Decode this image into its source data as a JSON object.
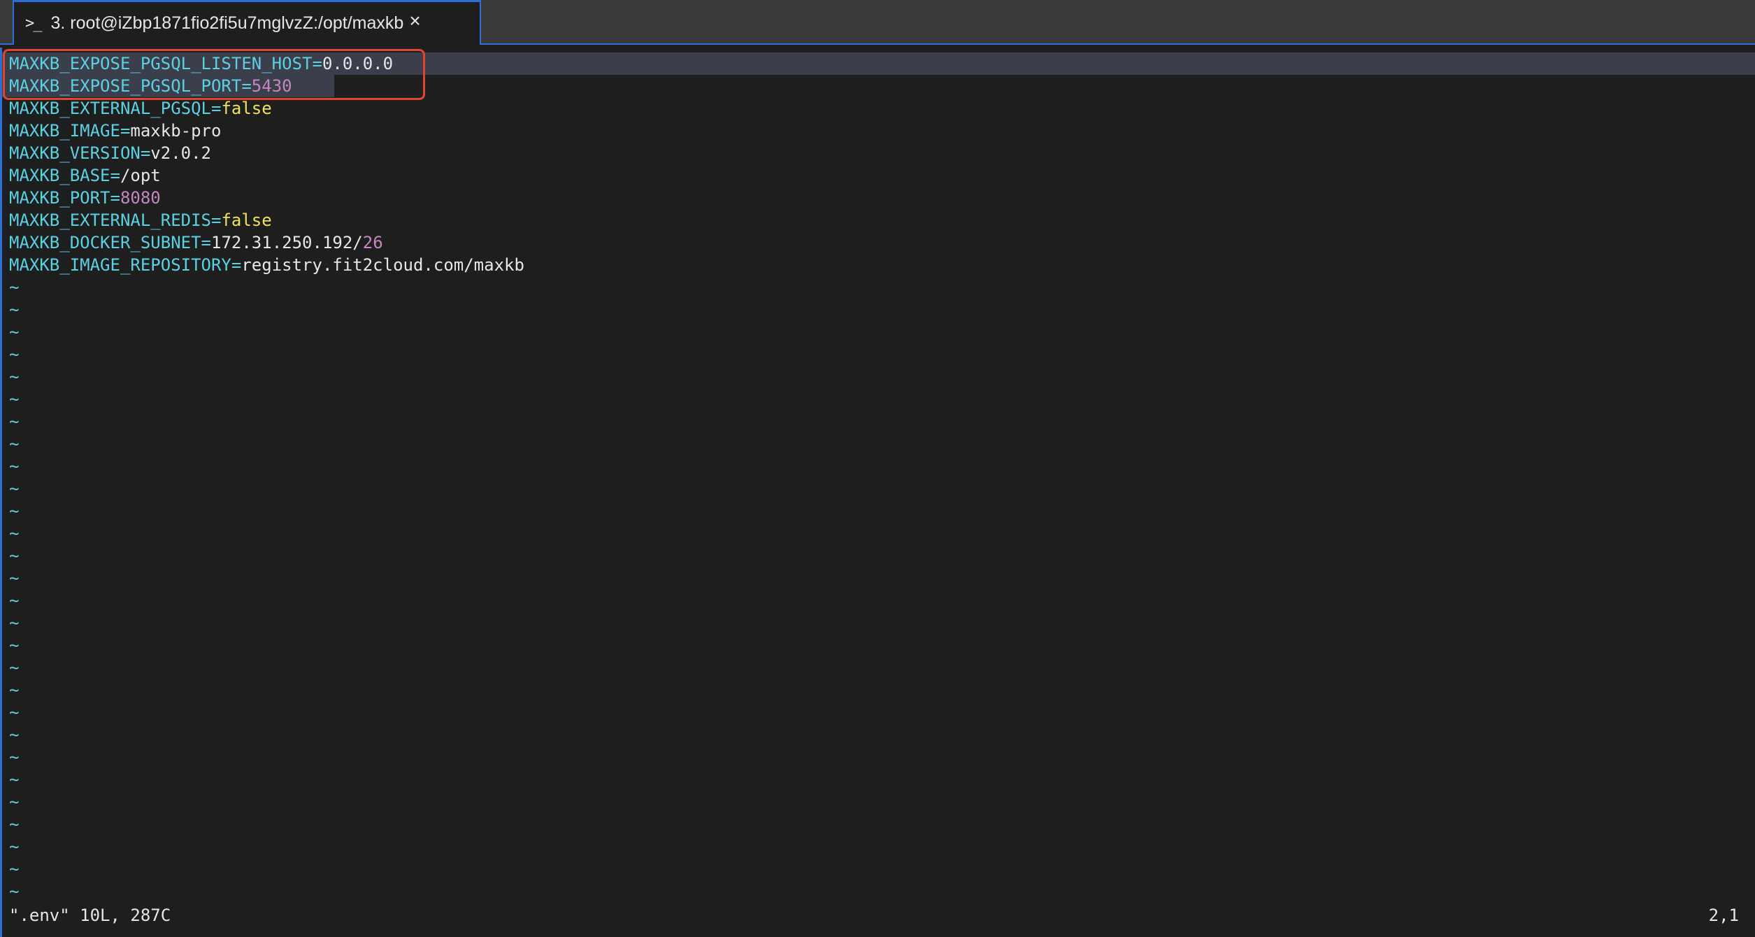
{
  "tab": {
    "prompt_glyph": ">_",
    "title": "3. root@iZbp1871fio2fi5u7mglvzZ:/opt/maxkb",
    "close_glyph": "×"
  },
  "file_lines": [
    {
      "key": "MAXKB_EXPOSE_PGSQL_LISTEN_HOST",
      "value": "0.0.0.0",
      "value_type": "text"
    },
    {
      "key": "MAXKB_EXPOSE_PGSQL_PORT",
      "value": "5430",
      "value_type": "number"
    },
    {
      "key": "MAXKB_EXTERNAL_PGSQL",
      "value": "false",
      "value_type": "bool"
    },
    {
      "key": "MAXKB_IMAGE",
      "value": "maxkb-pro",
      "value_type": "text"
    },
    {
      "key": "MAXKB_VERSION",
      "value": "v2.0.2",
      "value_type": "text"
    },
    {
      "key": "MAXKB_BASE",
      "value": "/opt",
      "value_type": "text"
    },
    {
      "key": "MAXKB_PORT",
      "value": "8080",
      "value_type": "number"
    },
    {
      "key": "MAXKB_EXTERNAL_REDIS",
      "value": "false",
      "value_type": "bool"
    },
    {
      "key": "MAXKB_DOCKER_SUBNET",
      "value": "172.31.250.192/",
      "value_suffix": "26",
      "value_type": "text"
    },
    {
      "key": "MAXKB_IMAGE_REPOSITORY",
      "value": "registry.fit2cloud.com/maxkb",
      "value_type": "text"
    }
  ],
  "empty_line_marker": "~",
  "empty_line_count": 28,
  "status": {
    "file_info": "\".env\" 10L, 287C",
    "cursor_position": "2,1"
  },
  "colors": {
    "key": "#5ad1e3",
    "bool": "#f1e05a",
    "number": "#c586c0",
    "highlight_box": "#e0452e",
    "tab_accent": "#2c6fd6"
  }
}
